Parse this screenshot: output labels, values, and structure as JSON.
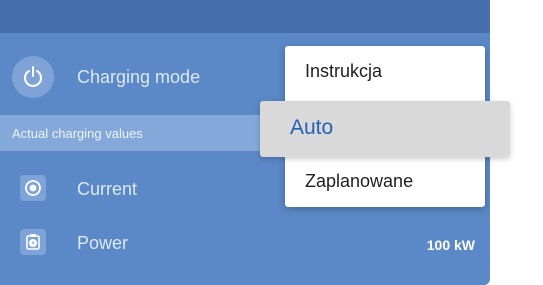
{
  "mode_row": {
    "label": "Charging mode",
    "icon": "power-icon"
  },
  "section": {
    "title": "Actual charging values"
  },
  "metrics": [
    {
      "label": "Current",
      "icon": "current-icon",
      "value": ""
    },
    {
      "label": "Power",
      "icon": "power-plug-icon",
      "value": "100 kW"
    }
  ],
  "dropdown": {
    "options": [
      "Instrukcja",
      "Auto",
      "Zaplanowane"
    ],
    "selected": "Auto"
  },
  "colors": {
    "panel_bg": "#5b88c7",
    "topbar_bg": "#456fab",
    "section_bg": "#84a8da",
    "selected_text": "#2461b4",
    "selected_bg": "#d9d9d9"
  }
}
